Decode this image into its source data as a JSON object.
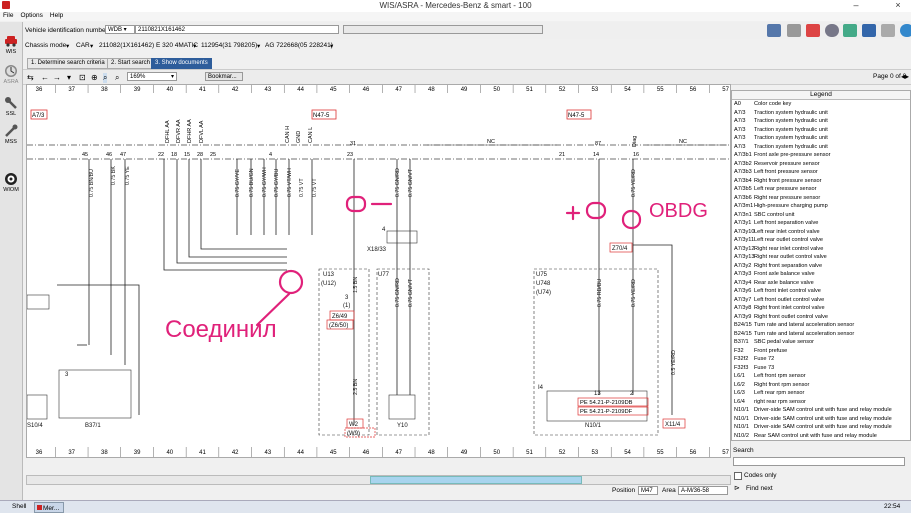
{
  "window": {
    "title": "WIS/ASRA - Mercedes-Benz & smart - 100",
    "minimize": "–",
    "close": "×"
  },
  "menu": [
    "File",
    "Options",
    "Help"
  ],
  "sidebar": [
    {
      "label": "WIS",
      "icon": "car-icon"
    },
    {
      "label": "ASRA",
      "icon": "clock-icon"
    },
    {
      "label": "SSL",
      "icon": "wrench-icon"
    },
    {
      "label": "MSS",
      "icon": "tools-icon"
    },
    {
      "label": "WIOM",
      "icon": "disc-icon"
    }
  ],
  "vin": {
    "label": "Vehicle identification number",
    "prefix": "WDB",
    "value": "2110821X161462"
  },
  "chassis": {
    "mode_label": "Chassis mode",
    "type": "CAR",
    "model": "211082(1X161462) E 320 4MATIC",
    "engine": "112954(31 798205)",
    "transmission": "AG 722668(05 228241)"
  },
  "steps": [
    "1. Determine search criteria",
    "2. Start search",
    "3. Show documents"
  ],
  "toolbar": {
    "zoom": "169%",
    "bookmark": "Bookmar...",
    "page": "Page 0 of 0"
  },
  "columns": [
    "36",
    "37",
    "38",
    "39",
    "40",
    "41",
    "42",
    "43",
    "44",
    "45",
    "46",
    "47",
    "48",
    "49",
    "50",
    "51",
    "52",
    "53",
    "54",
    "55",
    "56",
    "57"
  ],
  "diagram": {
    "refs": [
      "A7/3",
      "N47-5",
      "N47-5"
    ],
    "wires": [
      "0.75 BN/BU",
      "0.75 BK",
      "0.75 YE",
      "0.75 GY/YE",
      "0.75 BU/GN",
      "0.75 GY/WH",
      "0.75 GY/BU",
      "0.75 VT/WH",
      "0.75 VT",
      "0.75 VT",
      "0.75 GN/RD",
      "0.75 GN/VT",
      "0.75 GN/RD",
      "0.75 GN/VT",
      "0.75 RD/BU",
      "0.75 YE/RD",
      "0.75 YE/RD",
      "0.5 YE/RD",
      "1.5 BN",
      "2.5 BN"
    ],
    "top_labels": [
      "DFHL AA",
      "DFVR AA",
      "DFHR AA",
      "DFVL AA",
      "CAN H",
      "CAN L",
      "GND",
      "31",
      "87",
      "Diag"
    ],
    "pins": [
      "45",
      "46",
      "47",
      "22",
      "18",
      "15",
      "28",
      "25",
      "4",
      "23",
      "21",
      "14",
      "16"
    ],
    "nc": [
      "NC",
      "NC"
    ],
    "connectors": [
      "X18/33",
      "U13",
      "(U12)",
      "U77",
      "U75",
      "U748",
      "(U74)",
      "Z6/49",
      "(Z6/50)",
      "W2",
      "(W9)",
      "Y10",
      "Z70/4",
      "N10/1",
      "X11/4",
      "B37/1",
      "S10/4",
      "(1)",
      "3",
      "4",
      "I4",
      "13",
      "2",
      "3"
    ],
    "pe_refs": [
      "PE 54.21-P-2109DB",
      "PE 54.21-P-2109DF"
    ],
    "annotations": [
      "Соединил",
      "ОВDG"
    ]
  },
  "legend": {
    "title": "Legend",
    "items": [
      {
        "code": "A0",
        "text": "Color code key"
      },
      {
        "code": "A7/3",
        "text": "Traction system hydraulic unit"
      },
      {
        "code": "A7/3",
        "text": "Traction system hydraulic unit"
      },
      {
        "code": "A7/3",
        "text": "Traction system hydraulic unit"
      },
      {
        "code": "A7/3",
        "text": "Traction system hydraulic unit"
      },
      {
        "code": "A7/3",
        "text": "Traction system hydraulic unit"
      },
      {
        "code": "A7/3b1",
        "text": "Front axle pre-pressure sensor"
      },
      {
        "code": "A7/3b2",
        "text": "Reservoir pressure sensor"
      },
      {
        "code": "A7/3b3",
        "text": "Left front pressure sensor"
      },
      {
        "code": "A7/3b4",
        "text": "Right front pressure sensor"
      },
      {
        "code": "A7/3b5",
        "text": "Left rear pressure sensor"
      },
      {
        "code": "A7/3b6",
        "text": "Right rear pressure sensor"
      },
      {
        "code": "A7/3m1",
        "text": "High-pressure charging pump"
      },
      {
        "code": "A7/3n1",
        "text": "SBC control unit"
      },
      {
        "code": "A7/3y1",
        "text": "Left front separation valve"
      },
      {
        "code": "A7/3y10",
        "text": "Left rear inlet control valve"
      },
      {
        "code": "A7/3y11",
        "text": "Left rear outlet control valve"
      },
      {
        "code": "A7/3y12",
        "text": "Right rear inlet control valve"
      },
      {
        "code": "A7/3y13",
        "text": "Right rear outlet control valve"
      },
      {
        "code": "A7/3y2",
        "text": "Right front separation valve"
      },
      {
        "code": "A7/3y3",
        "text": "Front axle balance valve"
      },
      {
        "code": "A7/3y4",
        "text": "Rear axle balance valve"
      },
      {
        "code": "A7/3y6",
        "text": "Left front inlet control valve"
      },
      {
        "code": "A7/3y7",
        "text": "Left front outlet control valve"
      },
      {
        "code": "A7/3y8",
        "text": "Right front inlet control valve"
      },
      {
        "code": "A7/3y9",
        "text": "Right front outlet control valve"
      },
      {
        "code": "B24/15",
        "text": "Turn rate and lateral acceleration sensor"
      },
      {
        "code": "B24/15",
        "text": "Turn rate and lateral acceleration sensor"
      },
      {
        "code": "B37/1",
        "text": "SBC pedal value sensor"
      },
      {
        "code": "F32",
        "text": "Front prefuse"
      },
      {
        "code": "F32f2",
        "text": "Fuse 72"
      },
      {
        "code": "F32f3",
        "text": "Fuse 73"
      },
      {
        "code": "L6/1",
        "text": "Left front rpm sensor"
      },
      {
        "code": "L6/2",
        "text": "Right front rpm sensor"
      },
      {
        "code": "L6/3",
        "text": "Left rear rpm sensor"
      },
      {
        "code": "L6/4",
        "text": "right rear rpm sensor"
      },
      {
        "code": "N10/1",
        "text": "Driver-side SAM control unit with fuse and relay module"
      },
      {
        "code": "N10/1",
        "text": "Driver-side SAM control unit with fuse and relay module"
      },
      {
        "code": "N10/1",
        "text": "Driver-side SAM control unit with fuse and relay module"
      },
      {
        "code": "N10/2",
        "text": "Rear SAM control unit with fuse and relay module"
      }
    ]
  },
  "search": {
    "label": "Search",
    "codes_only": "Codes only",
    "find_next": "Find next"
  },
  "status": {
    "position_label": "Position",
    "position": "M47",
    "area_label": "Area",
    "area": "A-M/36-58"
  },
  "taskbar": {
    "start": "Shell",
    "task": "Mer...",
    "clock": "22:54"
  },
  "colors": {
    "accent": "#2e5d9b",
    "annotation": "#e0217a",
    "ref_box": "#d33"
  }
}
